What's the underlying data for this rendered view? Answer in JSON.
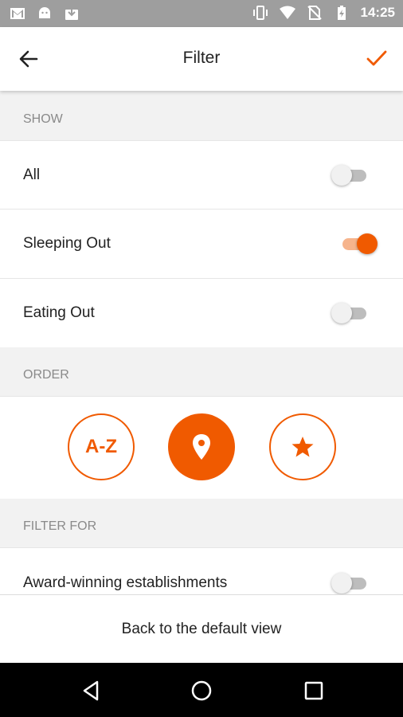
{
  "status_bar": {
    "time": "14:25",
    "left_icons": [
      "gmail-icon",
      "android-icon",
      "download-icon"
    ],
    "right_icons": [
      "vibrate-icon",
      "wifi-icon",
      "no-sim-icon",
      "battery-charging-icon"
    ]
  },
  "app_bar": {
    "title": "Filter",
    "back_icon": "arrow-back-icon",
    "confirm_icon": "check-icon"
  },
  "sections": {
    "show": {
      "header": "SHOW",
      "items": [
        {
          "label": "All",
          "enabled": false
        },
        {
          "label": "Sleeping Out",
          "enabled": true
        },
        {
          "label": "Eating Out",
          "enabled": false
        }
      ]
    },
    "order": {
      "header": "ORDER",
      "options": [
        {
          "name": "alphabetical",
          "label": "A-Z",
          "selected": false
        },
        {
          "name": "distance",
          "icon": "location-pin-icon",
          "selected": true
        },
        {
          "name": "rating",
          "icon": "star-icon",
          "selected": false
        }
      ]
    },
    "filter_for": {
      "header": "FILTER FOR",
      "items": [
        {
          "label": "Award-winning establishments",
          "enabled": false
        }
      ]
    }
  },
  "footer": {
    "reset_label": "Back to the default view"
  },
  "nav_bar": {
    "buttons": [
      "back-triangle-icon",
      "home-circle-icon",
      "recents-square-icon"
    ]
  },
  "colors": {
    "accent": "#f05a00",
    "accent_light": "#f6b48c",
    "status_bar": "#9e9e9e",
    "background": "#f2f2f2"
  }
}
